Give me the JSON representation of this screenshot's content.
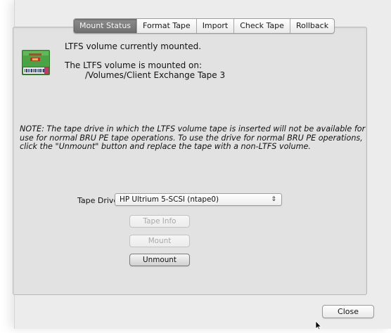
{
  "tabs": [
    {
      "label": "Mount Status",
      "selected": true
    },
    {
      "label": "Format Tape",
      "selected": false
    },
    {
      "label": "Import",
      "selected": false
    },
    {
      "label": "Check Tape",
      "selected": false
    },
    {
      "label": "Rollback",
      "selected": false
    }
  ],
  "status": {
    "line1": "LTFS volume currently mounted.",
    "line2": "The LTFS volume is mounted on:",
    "mount_path": "/Volumes/Client Exchange Tape 3"
  },
  "note": "NOTE: The tape drive in which the LTFS volume tape is inserted will not be available for use for normal BRU PE tape operations.  To use the drive for normal BRU PE operations, click the \"Unmount\" button and replace the tape with a non-LTFS volume.",
  "tape_drive": {
    "label": "Tape Drive:",
    "selected": "HP Ultrium 5-SCSI (ntape0)"
  },
  "buttons": {
    "tape_info": "Tape Info",
    "mount": "Mount",
    "unmount": "Unmount",
    "close": "Close"
  },
  "icons": {
    "tape": "ltfs-tape-icon",
    "cursor": "mouse-pointer-icon"
  },
  "colors": {
    "tape_green": "#3f9a3a",
    "selected_tab": "#777777"
  }
}
